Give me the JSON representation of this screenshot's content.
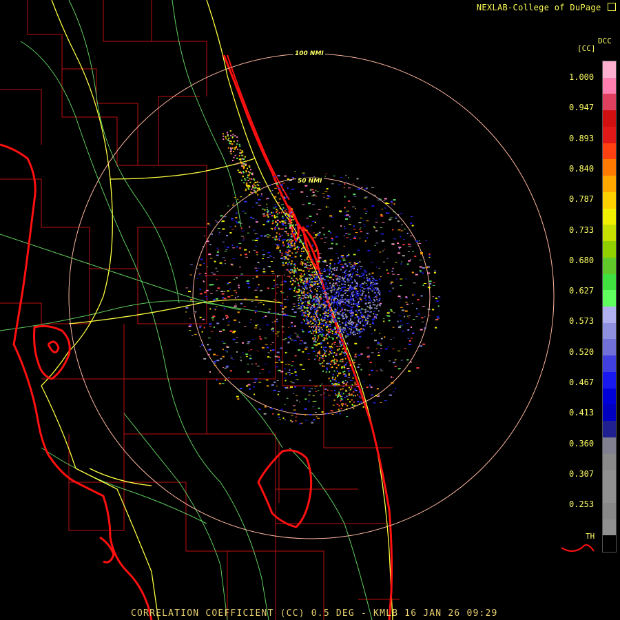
{
  "header": {
    "credit": "NEXLAB-College of DuPage",
    "credit_icon": "logo-icon"
  },
  "title": "CORRELATION COEFFICIENT (CC) 0.5 DEG - KMLB 16 JAN 26 09:29",
  "rings": {
    "outer_label": "100 NMI",
    "inner_label": "50 NMI"
  },
  "legend": {
    "product_code": "DCC",
    "unit": "[CC]",
    "values": [
      "1.000",
      "0.947",
      "0.893",
      "0.840",
      "0.787",
      "0.733",
      "0.680",
      "0.627",
      "0.573",
      "0.520",
      "0.467",
      "0.413",
      "0.360",
      "0.307",
      "0.253"
    ],
    "th_label": "TH",
    "colors": [
      "#ffb0d0",
      "#ff80b0",
      "#e04060",
      "#d01010",
      "#e01818",
      "#ff4010",
      "#ff7a00",
      "#ffa800",
      "#ffd000",
      "#f0f000",
      "#c8e000",
      "#90d000",
      "#60c828",
      "#40e040",
      "#60ff60",
      "#b0b0f0",
      "#9090e0",
      "#7070d8",
      "#4040e0",
      "#1818f0",
      "#0000d8",
      "#0000c0",
      "#202090",
      "#808090",
      "#8a8a8a",
      "#909090",
      "#909090",
      "#888888",
      "#909090",
      "#000000"
    ]
  },
  "colors": {
    "background": "#000000",
    "coast": "#ff1010",
    "county": "#c01010",
    "highway": "#ffff40",
    "road": "#60d060",
    "ring": "#ffb8a0",
    "text": "#ffff66"
  }
}
